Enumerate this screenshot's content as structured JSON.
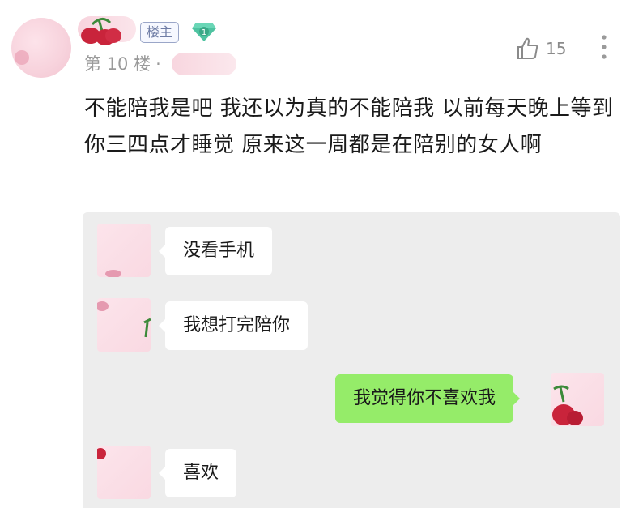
{
  "post": {
    "badge_op": "楼主",
    "level_badge": "1",
    "floor": "第 10 楼",
    "separator": "·",
    "likes": "15",
    "comment": "不能陪我是吧 我还以为真的不能陪我 以前每天晚上等到你三四点才睡觉 原来这一周都是在陪别的女人啊"
  },
  "chat": {
    "messages": [
      {
        "side": "left",
        "text": "没看手机"
      },
      {
        "side": "left",
        "text": "我想打完陪你"
      },
      {
        "side": "right",
        "text": "我觉得你不喜欢我"
      },
      {
        "side": "left",
        "text": "喜欢"
      }
    ],
    "colors": {
      "background": "#ededed",
      "left_bubble": "#ffffff",
      "right_bubble": "#95ec69"
    }
  },
  "icons": {
    "like": "thumbs-up-icon",
    "more": "more-vertical-icon",
    "level": "diamond-level-icon"
  }
}
